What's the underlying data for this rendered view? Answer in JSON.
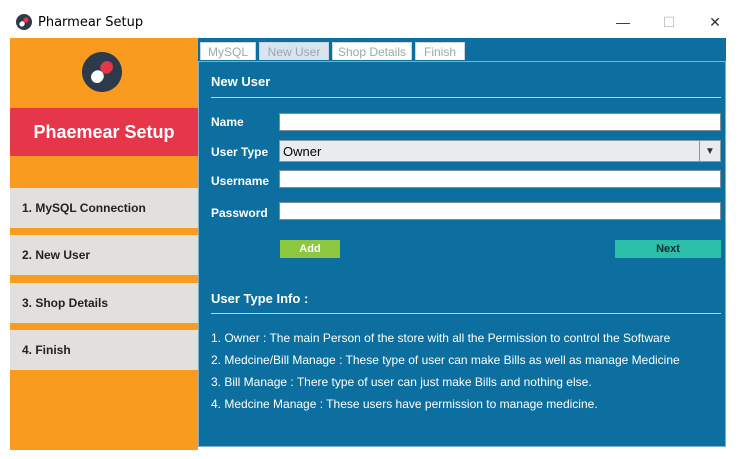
{
  "window": {
    "title": "Pharmear Setup",
    "icon": "pill-capsule-icon"
  },
  "window_controls": {
    "minimize": "—",
    "maximize": "☐",
    "close": "✕"
  },
  "sidebar": {
    "banner_title": "Phaemear Setup",
    "steps": [
      {
        "label": "1. MySQL Connection"
      },
      {
        "label": "2. New User"
      },
      {
        "label": "3. Shop Details"
      },
      {
        "label": "4. Finish"
      }
    ]
  },
  "tabs": [
    {
      "label": "MySQL",
      "active": false
    },
    {
      "label": "New User",
      "active": true
    },
    {
      "label": "Shop Details",
      "active": false
    },
    {
      "label": "Finish",
      "active": false
    }
  ],
  "form": {
    "heading": "New User",
    "name_label": "Name",
    "name_value": "",
    "user_type_label": "User Type",
    "user_type_value": "Owner",
    "username_label": "Username",
    "username_value": "",
    "password_label": "Password",
    "password_value": "",
    "add_button": "Add",
    "next_button": "Next"
  },
  "info": {
    "heading": "User Type Info :",
    "lines": [
      "1. Owner : The main Person of the store with all the Permission to control the Software",
      "2. Medcine/Bill Manage : These type of user can make Bills as well as manage Medicine",
      "3. Bill Manage : There type of user can just make Bills and nothing else.",
      "4. Medcine Manage : These users have permission to manage medicine."
    ]
  },
  "colors": {
    "sidebar": "#f99b1f",
    "banner": "#e5364a",
    "content": "#0c6fa0",
    "add_button": "#8dc63f",
    "next_button": "#2bbfa8"
  }
}
